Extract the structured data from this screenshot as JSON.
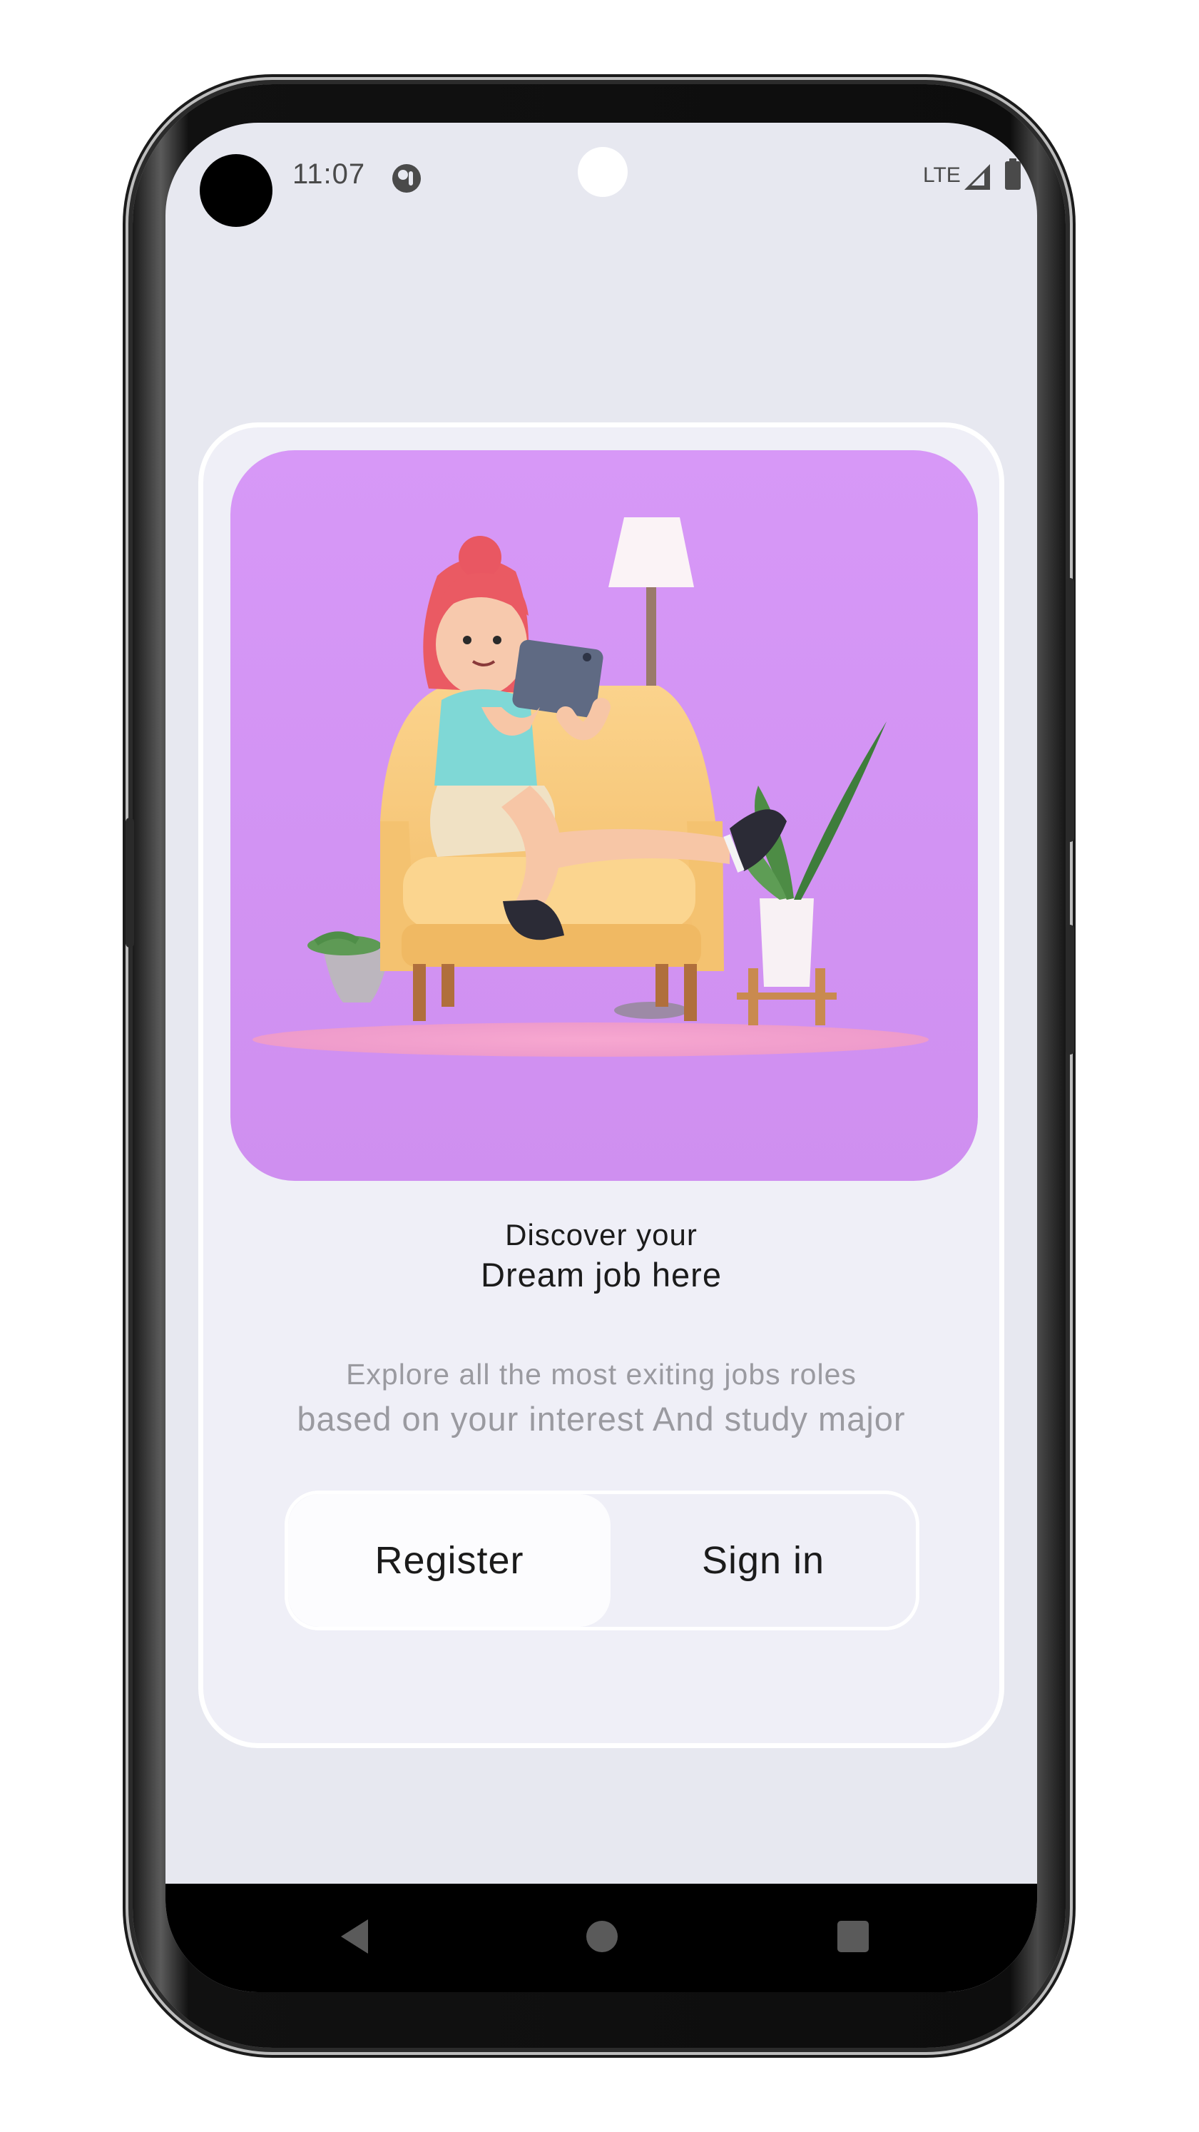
{
  "status_bar": {
    "time": "11:07",
    "network": "LTE",
    "icons": [
      "app-notification-icon",
      "signal-icon",
      "battery-icon"
    ]
  },
  "hero": {
    "image_description_icon": "girl-on-armchair-illustration",
    "background_color": "#d798f7"
  },
  "content": {
    "headline_line1": "Discover your",
    "headline_line2": "Dream job here",
    "subtitle_line1": "Explore all the most exiting jobs roles",
    "subtitle_line2": "based on your interest And study major"
  },
  "auth_toggle": {
    "register_label": "Register",
    "signin_label": "Sign in",
    "selected": "Register"
  },
  "nav_bar": {
    "icons": [
      "back-icon",
      "home-icon",
      "recents-icon"
    ]
  },
  "colors": {
    "screen_bg": "#e7e8f0",
    "card_bg": "#efeff7",
    "text_primary": "#1b1b1b",
    "text_secondary": "#9a9aa0"
  }
}
